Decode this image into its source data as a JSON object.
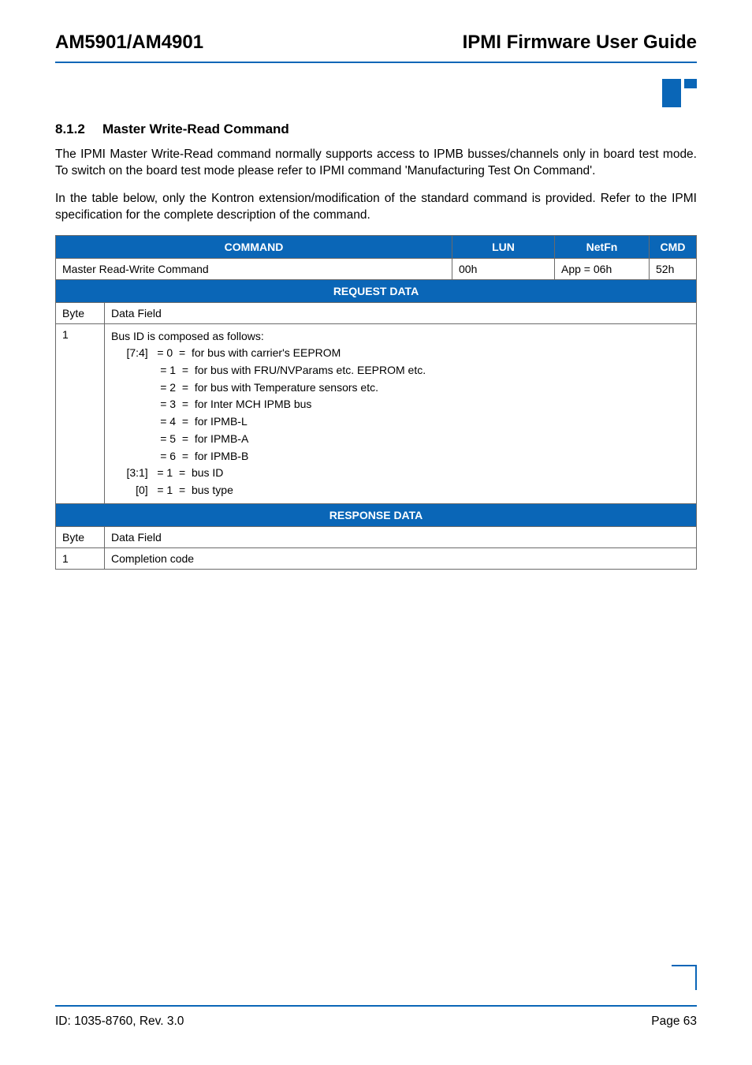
{
  "header": {
    "left": "AM5901/AM4901",
    "right": "IPMI Firmware User Guide"
  },
  "section": {
    "num": "8.1.2",
    "title": "Master Write-Read Command"
  },
  "paras": {
    "p1": "The IPMI Master Write-Read command normally supports access to IPMB busses/channels only in board test mode. To switch on the board test mode please refer to IPMI command 'Manufacturing Test On Command'.",
    "p2": "In the table below, only the Kontron extension/modification of the standard command is provided. Refer to the IPMI specification for the complete description of the command."
  },
  "table": {
    "headers": {
      "command": "COMMAND",
      "lun": "LUN",
      "netfn": "NetFn",
      "cmd": "CMD"
    },
    "row1": {
      "command": "Master Read-Write Command",
      "lun": "00h",
      "netfn": "App = 06h",
      "cmd": "52h"
    },
    "request_header": "REQUEST DATA",
    "req_cols": {
      "byte": "Byte",
      "field": "Data Field"
    },
    "req_row": {
      "byte": "1",
      "l0": "Bus ID is composed as follows:",
      "l1": "     [7:4]   = 0  =  for bus with carrier's EEPROM",
      "l2": "                = 1  =  for bus with FRU/NVParams etc. EEPROM etc.",
      "l3": "                = 2  =  for bus with Temperature sensors etc.",
      "l4": "                = 3  =  for Inter MCH IPMB bus",
      "l5": "                = 4  =  for IPMB-L",
      "l6": "                = 5  =  for IPMB-A",
      "l7": "                = 6  =  for IPMB-B",
      "l8": "     [3:1]   = 1  =  bus ID",
      "l9": "        [0]   = 1  =  bus type"
    },
    "response_header": "RESPONSE DATA",
    "resp_cols": {
      "byte": "Byte",
      "field": "Data Field"
    },
    "resp_row": {
      "byte": "1",
      "field": "Completion code"
    }
  },
  "footer": {
    "left": "ID: 1035-8760, Rev. 3.0",
    "right": "Page 63"
  }
}
